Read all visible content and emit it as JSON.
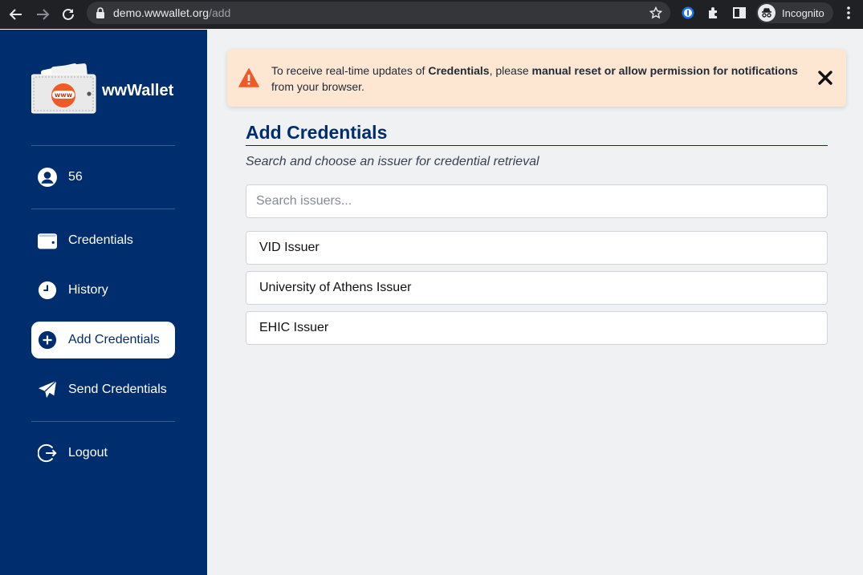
{
  "browser": {
    "url_domain": "demo.wwwallet.org",
    "url_path": "/add",
    "profile_label": "Incognito"
  },
  "sidebar": {
    "logo_badge": "www",
    "app_name": "wwWallet",
    "user_name": "56",
    "items": [
      {
        "label": "Credentials",
        "icon": "wallet-icon"
      },
      {
        "label": "History",
        "icon": "clock-icon"
      },
      {
        "label": "Add Credentials",
        "icon": "plus-circle-icon"
      },
      {
        "label": "Send Credentials",
        "icon": "paper-plane-icon"
      },
      {
        "label": "Logout",
        "icon": "logout-icon"
      }
    ]
  },
  "banner": {
    "text_1": "To receive real-time updates of ",
    "bold_1": "Credentials",
    "text_2": ", please ",
    "bold_2": "manual reset or allow permission for notifications",
    "text_3": " from your browser."
  },
  "main": {
    "title": "Add Credentials",
    "subtitle": "Search and choose an issuer for credential retrieval",
    "search_placeholder": "Search issuers...",
    "issuers": [
      "VID Issuer",
      "University of Athens Issuer",
      "EHIC Issuer"
    ]
  },
  "colors": {
    "sidebar_bg": "#002d6e",
    "banner_bg": "#fde7d3",
    "warning": "#f05a28"
  }
}
